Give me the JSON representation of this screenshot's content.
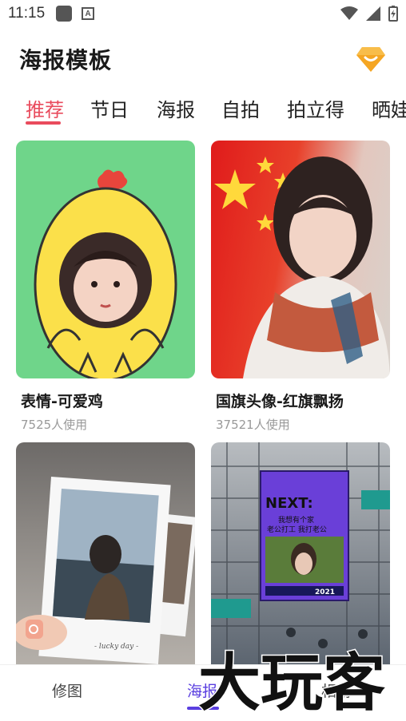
{
  "status": {
    "time": "11:15"
  },
  "header": {
    "title": "海报模板"
  },
  "tabs": [
    {
      "label": "推荐",
      "active": true
    },
    {
      "label": "节日"
    },
    {
      "label": "海报"
    },
    {
      "label": "自拍"
    },
    {
      "label": "拍立得"
    },
    {
      "label": "晒娃"
    }
  ],
  "templates": [
    {
      "title": "表情-可爱鸡",
      "usage": "7525人使用"
    },
    {
      "title": "国旗头像-红旗飘扬",
      "usage": "37521人使用"
    },
    {
      "title": "",
      "usage": ""
    },
    {
      "title": "",
      "usage": ""
    }
  ],
  "card_texts": {
    "polaroid_caption": "- lucky day -",
    "poster_headline": "NEXT:",
    "poster_line1": "我想有个家",
    "poster_line2": "老公打工 我打老公",
    "poster_year": "2021"
  },
  "bottom_nav": [
    {
      "label": "修图"
    },
    {
      "label": "海报",
      "active": true
    },
    {
      "label": "相册"
    }
  ],
  "watermark": {
    "text": "大玩客"
  },
  "colors": {
    "accent": "#e94b5d",
    "nav_active": "#5a3fe0",
    "vip": "#f5a623"
  }
}
